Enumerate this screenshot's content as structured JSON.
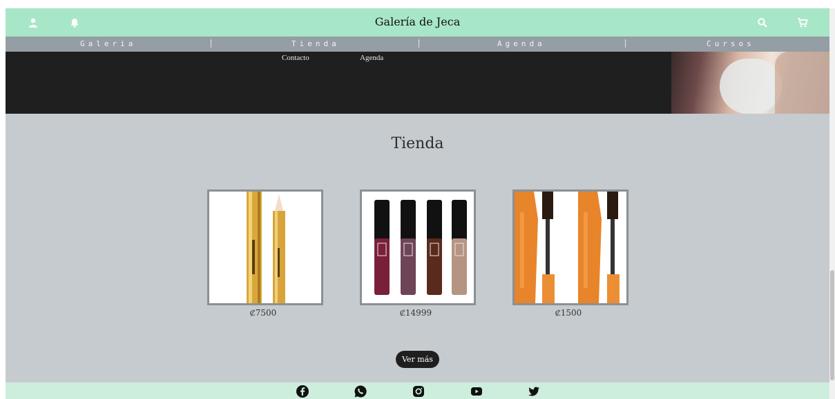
{
  "header": {
    "title": "Galería de Jeca",
    "icons": [
      "user-icon",
      "bell-icon",
      "search-icon",
      "cart-icon"
    ]
  },
  "nav": {
    "items": [
      "Galeria",
      "Tienda",
      "Agenda",
      "Cursos"
    ]
  },
  "hero": {
    "links": [
      "Contacto",
      "Agenda"
    ]
  },
  "shop": {
    "heading": "Tienda",
    "products": [
      {
        "name": "concealer-pen",
        "price": "₡7500"
      },
      {
        "name": "lip-gloss-set",
        "price": "₡14999"
      },
      {
        "name": "mascara",
        "price": "₡1500"
      }
    ],
    "more_button": "Ver más"
  },
  "footer": {
    "social": [
      "facebook-icon",
      "whatsapp-icon",
      "instagram-icon",
      "youtube-icon",
      "twitter-icon"
    ]
  },
  "colors": {
    "accent_mint": "#a8e6c8",
    "nav_gray": "#949ea4",
    "hero_dark": "#1f1f1f",
    "shop_bg": "#c6cbcf",
    "footer_mint": "#cdeedd"
  }
}
